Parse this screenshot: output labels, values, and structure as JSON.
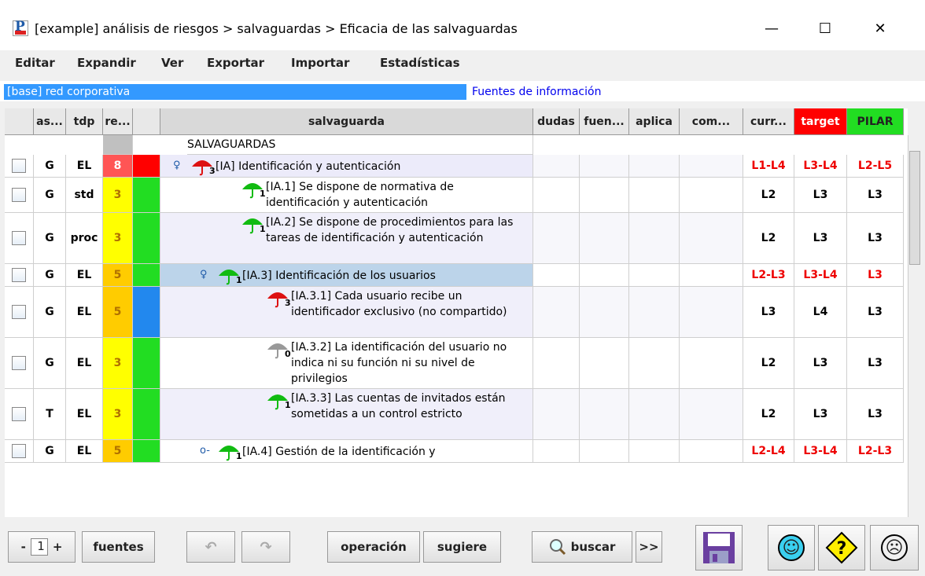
{
  "window": {
    "title": "[example] análisis de riesgos > salvaguardas > Eficacia de las salvaguardas",
    "minimize": "—",
    "maximize": "☐",
    "close": "✕"
  },
  "menu": [
    "Editar",
    "Expandir",
    "Ver",
    "Exportar",
    "Importar",
    "Estadísticas"
  ],
  "path": {
    "base": "[base] red corporativa",
    "fuentes": "Fuentes de información"
  },
  "columns": {
    "as": "as...",
    "tdp": "tdp",
    "re": "re...",
    "salvaguarda": "salvaguarda",
    "dudas": "dudas",
    "fuentes": "fuen...",
    "aplica": "aplica",
    "com": "com...",
    "current": "curr...",
    "target": "target",
    "pilar": "PILAR"
  },
  "group_label": "SALVAGUARDAS",
  "rows": [
    {
      "as": "G",
      "tdp": "EL",
      "re": "8",
      "text": "[IA] Identificación y autenticación",
      "badge": "3",
      "umbrella": "red",
      "current": "L1-L4",
      "target": "L3-L4",
      "pilar": "L2-L5",
      "levels_red": true
    },
    {
      "as": "G",
      "tdp": "std",
      "re": "3",
      "text": "[IA.1] Se dispone de normativa de identificación y autenticación",
      "badge": "1",
      "umbrella": "green",
      "current": "L2",
      "target": "L3",
      "pilar": "L3"
    },
    {
      "as": "G",
      "tdp": "proc",
      "re": "3",
      "text": "[IA.2] Se dispone de procedimientos para las tareas de identificación y autenticación",
      "badge": "1",
      "umbrella": "green",
      "current": "L2",
      "target": "L3",
      "pilar": "L3"
    },
    {
      "as": "G",
      "tdp": "EL",
      "re": "5",
      "text": "[IA.3] Identificación de los usuarios",
      "badge": "1",
      "umbrella": "green",
      "current": "L2-L3",
      "target": "L3-L4",
      "pilar": "L3",
      "levels_red": true
    },
    {
      "as": "G",
      "tdp": "EL",
      "re": "5",
      "text": "[IA.3.1] Cada usuario recibe un identificador exclusivo (no compartido)",
      "badge": "3",
      "umbrella": "red",
      "current": "L3",
      "target": "L4",
      "pilar": "L3"
    },
    {
      "as": "G",
      "tdp": "EL",
      "re": "3",
      "text": "[IA.3.2] La identificación del usuario no indica ni su función ni su nivel de privilegios",
      "badge": "0",
      "umbrella": "gray",
      "current": "L2",
      "target": "L3",
      "pilar": "L3"
    },
    {
      "as": "T",
      "tdp": "EL",
      "re": "3",
      "text": "[IA.3.3] Las cuentas de invitados están sometidas a un control estricto",
      "badge": "1",
      "umbrella": "green",
      "current": "L2",
      "target": "L3",
      "pilar": "L3"
    },
    {
      "as": "G",
      "tdp": "EL",
      "re": "5",
      "text": "[IA.4] Gestión de la identificación y",
      "badge": "1",
      "umbrella": "green",
      "current": "L2-L4",
      "target": "L3-L4",
      "pilar": "L2-L3",
      "levels_red": true
    }
  ],
  "bottom": {
    "minus": "-",
    "page": "1",
    "plus": "+",
    "fuentes": "fuentes",
    "undo": "↶",
    "redo": "↷",
    "operacion": "operación",
    "sugiere": "sugiere",
    "buscar": "buscar",
    "more": ">>",
    "happy": "☺",
    "warn": "?",
    "sad": "☹"
  },
  "colors": {
    "selection": "#3399ff",
    "red": "#ff0000",
    "green": "#22dd22",
    "yellow": "#ffff00",
    "orange": "#ffcc00",
    "risk_red": "#ff5555",
    "blue": "#2288ee"
  }
}
